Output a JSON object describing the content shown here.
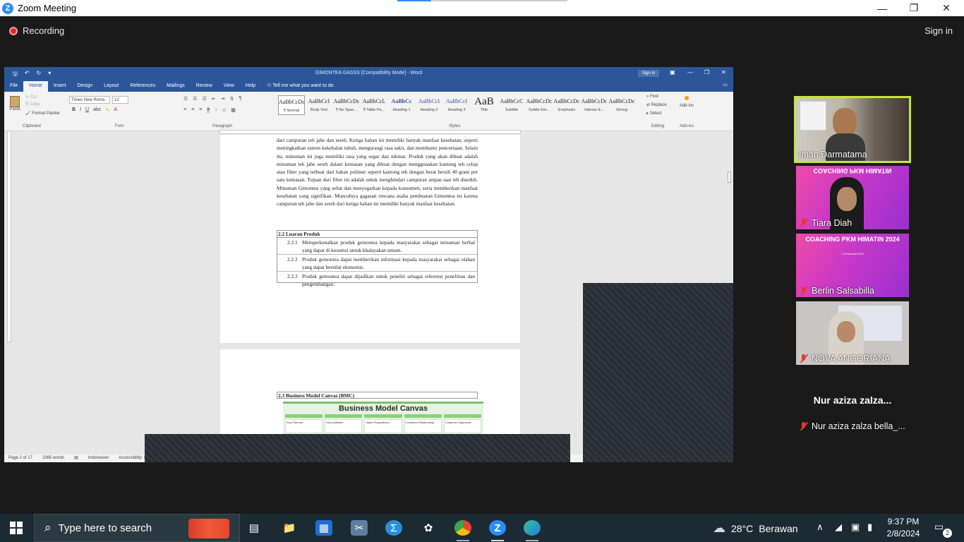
{
  "zoom": {
    "title": "Zoom Meeting",
    "recording_label": "Recording",
    "sign_in": "Sign in",
    "controls": {
      "minimize": "—",
      "restore": "❐",
      "close": "✕"
    }
  },
  "word": {
    "window_title": "GIMONTEA GASSS [Compatibility Mode] - Word",
    "sign_in": "Sign in",
    "tabs": [
      "File",
      "Home",
      "Insert",
      "Design",
      "Layout",
      "References",
      "Mailings",
      "Review",
      "View",
      "Help"
    ],
    "active_tab": "Home",
    "tell_me": "Tell me what you want to do",
    "clipboard": {
      "paste": "Paste",
      "cut": "Cut",
      "copy": "Copy",
      "format_painter": "Format Painter",
      "label": "Clipboard"
    },
    "font": {
      "name": "Times New Roma",
      "size": "12",
      "label": "Font"
    },
    "paragraph_label": "Paragraph",
    "styles_label": "Styles",
    "styles": [
      {
        "sample": "AaBbCcDc",
        "name": "¶ Normal"
      },
      {
        "sample": "AaBbCcI",
        "name": "Body Text"
      },
      {
        "sample": "AaBbCcDc",
        "name": "¶ No Spac..."
      },
      {
        "sample": "AaBbCcL",
        "name": "¶ Table Pa..."
      },
      {
        "sample": "AaBbCc",
        "name": "Heading 1"
      },
      {
        "sample": "AaBbCcI",
        "name": "Heading 2"
      },
      {
        "sample": "AaBbCcI",
        "name": "Heading 3"
      },
      {
        "sample": "AaB",
        "name": "Title"
      },
      {
        "sample": "AaBbCcC",
        "name": "Subtitle"
      },
      {
        "sample": "AaBbCcDc",
        "name": "Subtle Em..."
      },
      {
        "sample": "AaBbCcDc",
        "name": "Emphasis"
      },
      {
        "sample": "AaBbCcDc",
        "name": "Intense E..."
      },
      {
        "sample": "AaBbCcDc",
        "name": "Strong"
      }
    ],
    "editing": {
      "find": "Find",
      "replace": "Replace",
      "select": "Select",
      "label": "Editing"
    },
    "addins": {
      "name": "Add-ins",
      "label": "Add-ins"
    },
    "document": {
      "para1": "dari campuran teh jahe dan sereh. Ketiga bahan ini memiliki banyak manfaat kesehatan, seperti meningkatkan sistem kekebalan tubuh, mengurangi rasa sakit, dan membantu pencernaan. Selain itu, minuman ini juga memiliki rasa yang segar dan nikmat. Produk yang akan dibuat adalah minuman teh jahe sereh dalam kemasan yang dibuat dengan menggunakan kantong teh celup atau filter yang terbuat dari bahan polimer seperti kantong teh dengan berat bersih 40 gram per satu kemasan. Tujuan dari filter ini adalah untuk menghindari campuran ampas saat teh diseduh. Minuman Gimontea yang sehat dan menyegarkan kepada konsumen, serta memberikan manfaat kesehatan yang signifikan. Munculnya gagasan rencana usaha pembuatan Gimontea ini karena campuran teh jahe dan sereh dari ketiga bahan ini memiliki banyak manfaat kesehatan.",
      "section_22_title": "2.2 Luaran Produk",
      "section_22_items": [
        {
          "num": "2.2.1",
          "text": "Memperkenalkan produk gemontea kepada masyarakat sebagai minuman herbal yang dapat di kosumsi untuk khalayakan umum."
        },
        {
          "num": "2.2.2",
          "text": "Produk gemontea dapat memberikan informasi kepada masyarakat sebagai olahan yang dapat bernilai ekonomis."
        },
        {
          "num": "2.2.3",
          "text": "Produk gemontea dapat dijadikan untuk peneliti sebagai referensi penelitian dan pengembangan."
        }
      ],
      "section_23_title": "2.3 Business Model Canvas (BMC)",
      "bmc_title": "Business Model Canvas",
      "bmc_cells": [
        "Key Partners",
        "Key Activities",
        "Value Propositions",
        "Customer Relationship",
        "Customer Segments"
      ]
    },
    "status": {
      "page": "Page 2 of 17",
      "words": "2365 words",
      "language": "Indonesian",
      "accessibility": "Accessibility: I"
    }
  },
  "participants": [
    {
      "name": "Iman Darmatama",
      "muted": false,
      "active": true
    },
    {
      "name": "Tiara Diah",
      "muted": true,
      "banner": "COACHING PKM HIMATIN"
    },
    {
      "name": "Berlin Salsabilla",
      "muted": true,
      "banner": "COACHING PKM HIMATIN 2024",
      "banner_sub": "1-8 Februari 2024"
    },
    {
      "name": "NOVA ANGGRIANA",
      "muted": true
    },
    {
      "name": "Nur aziza zalza bella_...",
      "display": "Nur aziza zalza...",
      "muted": true
    }
  ],
  "taskbar": {
    "search_placeholder": "Type here to search",
    "weather_temp": "28°C",
    "weather_desc": "Berawan",
    "time": "9:37 PM",
    "date": "2/8/2024",
    "notifications": "2"
  }
}
